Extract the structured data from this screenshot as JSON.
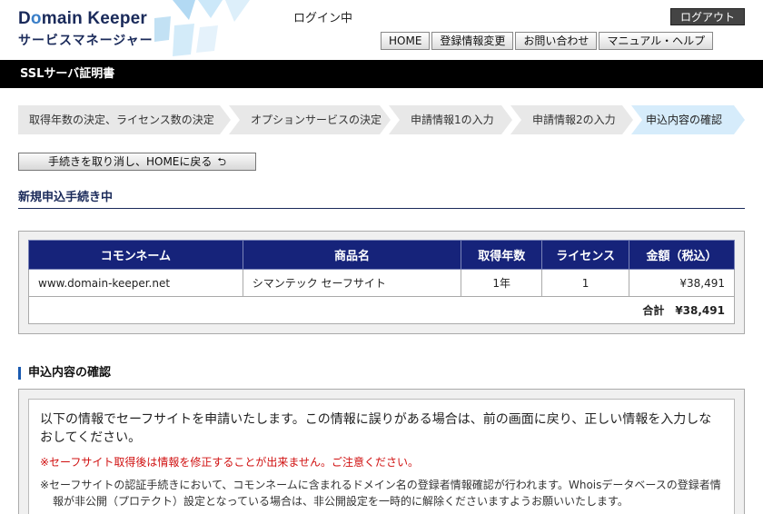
{
  "header": {
    "logo_prefix": "D",
    "logo_o": "o",
    "logo_rest": "main Keeper",
    "logo_subtitle": "サービスマネージャー",
    "login_status": "ログイン中",
    "logout_label": "ログアウト",
    "nav": [
      {
        "label": "HOME"
      },
      {
        "label": "登録情報変更"
      },
      {
        "label": "お問い合わせ"
      },
      {
        "label": "マニュアル・ヘルプ"
      }
    ]
  },
  "title_bar": "SSLサーバ証明書",
  "steps": [
    {
      "label": "取得年数の決定、ライセンス数の決定"
    },
    {
      "label": "オプションサービスの決定"
    },
    {
      "label": "申請情報1の入力"
    },
    {
      "label": "申請情報2の入力"
    },
    {
      "label": "申込内容の確認"
    }
  ],
  "cancel_button": "手続きを取り消し、HOMEに戻る",
  "section_heading": "新規申込手続き中",
  "order_table": {
    "headers": [
      "コモンネーム",
      "商品名",
      "取得年数",
      "ライセンス",
      "金額（税込）"
    ],
    "rows": [
      [
        "www.domain-keeper.net",
        "シマンテック セーフサイト",
        "1年",
        "1",
        "¥38,491"
      ]
    ],
    "total": "合計　¥38,491"
  },
  "confirm": {
    "heading": "申込内容の確認",
    "main_text": "以下の情報でセーフサイトを申請いたします。この情報に誤りがある場合は、前の画面に戻り、正しい情報を入力しなおしてください。",
    "warning": "※セーフサイト取得後は情報を修正することが出来ません。ご注意ください。",
    "note": "※セーフサイトの認証手続きにおいて、コモンネームに含まれるドメイン名の登録者情報確認が行われます。Whoisデータベースの登録者情報が非公開（プロテクト）設定となっている場合は、非公開設定を一時的に解除くださいますようお願いいたします。"
  }
}
